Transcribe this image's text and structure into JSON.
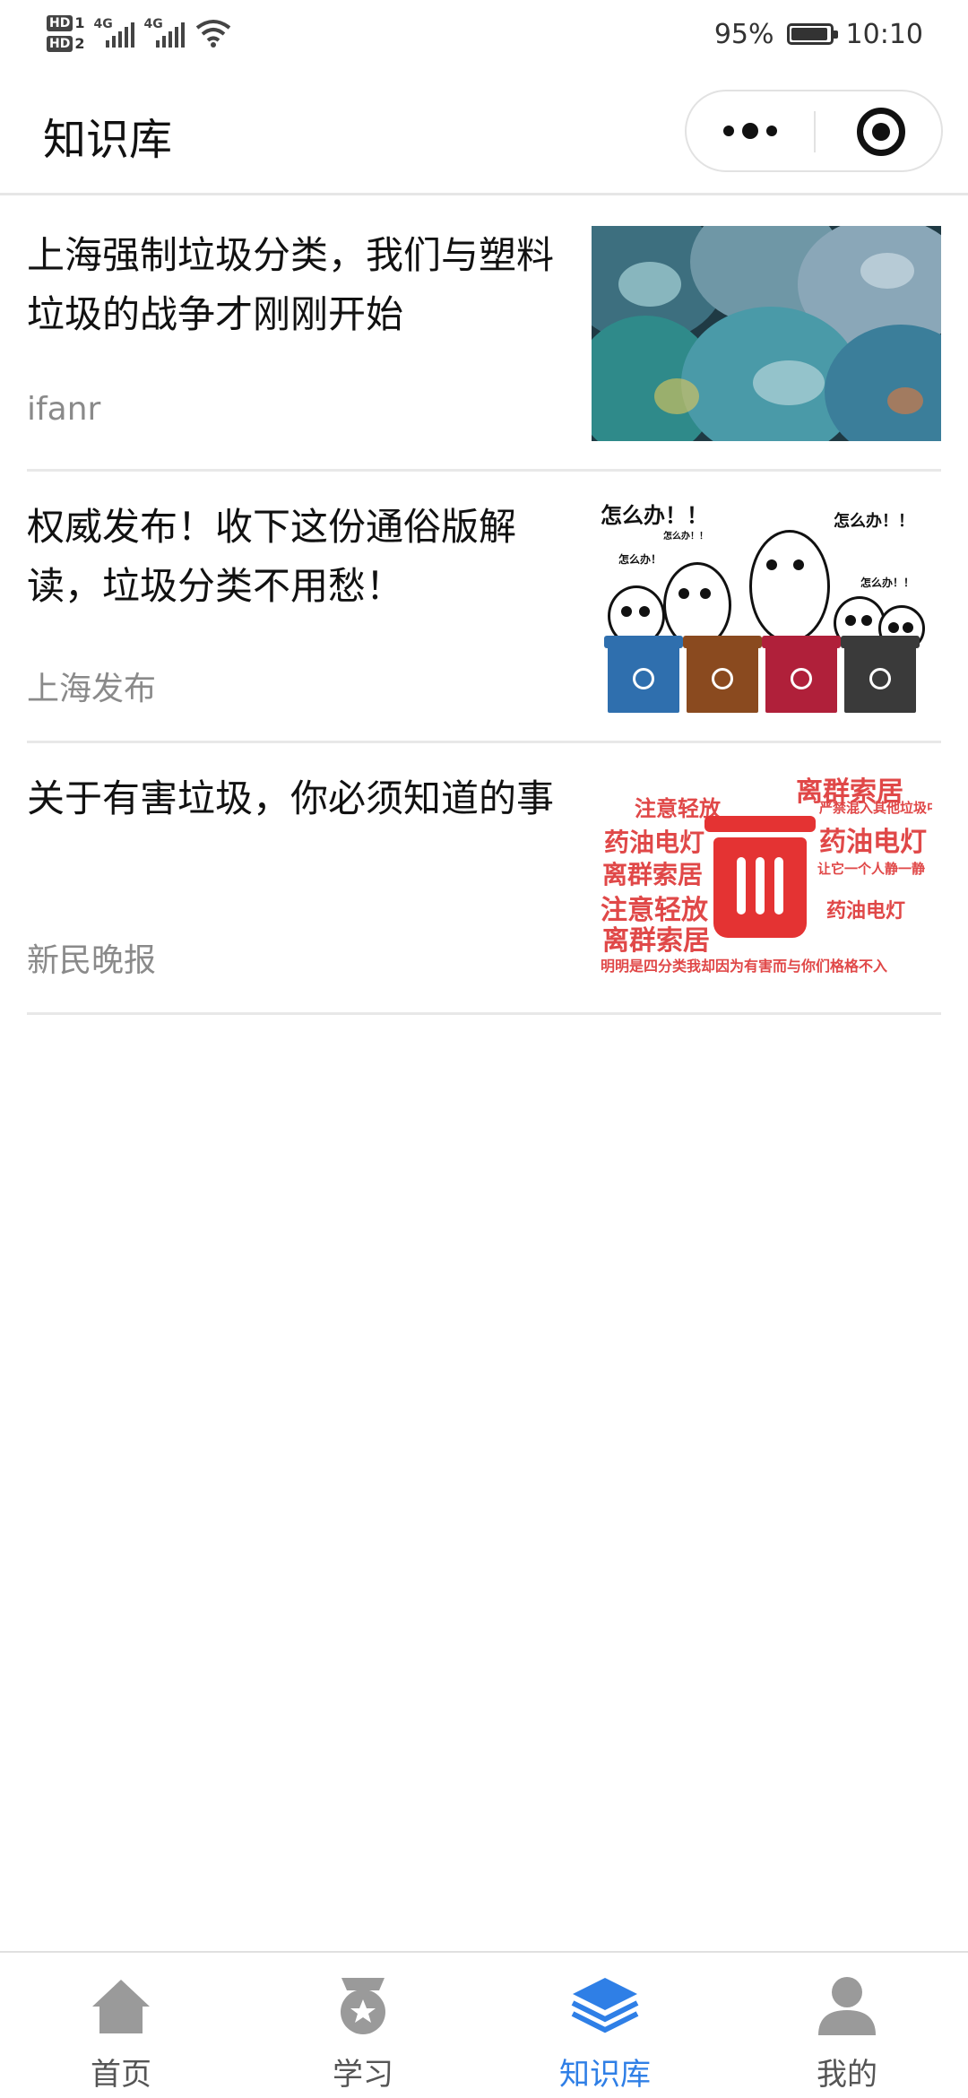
{
  "status_bar": {
    "sim1": "HD",
    "sim1_index": "1",
    "sim2": "HD",
    "sim2_index": "2",
    "network1": "4G",
    "network2": "4G",
    "battery_text": "95%",
    "battery_level": 0.95,
    "time": "10:10"
  },
  "header": {
    "title": "知识库",
    "more_icon": "more-dots-icon",
    "close_icon": "target-close-icon"
  },
  "articles": [
    {
      "title": "上海强制垃圾分类，我们与塑料垃圾的战争才刚刚开始",
      "source": "ifanr",
      "thumbnail": "plastic-bottle-bags-photo"
    },
    {
      "title": "权威发布！收下这份通俗版解读，垃圾分类不用愁！",
      "source": "上海发布",
      "thumbnail": "cartoon-trash-bins-illustration",
      "thumb_texts": [
        "怎么办！！",
        "怎么办！！",
        "怎么办！",
        "怎么办！！",
        "怎么办！！"
      ]
    },
    {
      "title": "关于有害垃圾，你必须知道的事",
      "source": "新民晚报",
      "thumbnail": "hazardous-waste-word-cloud",
      "thumb_texts": [
        "药油电灯",
        "离群索居",
        "注意轻放",
        "严禁混入其他垃圾中",
        "药油电灯",
        "离群索居",
        "注意轻放",
        "离群索居",
        "药油电灯",
        "让它一个人静一静",
        "明明是四分类我却因为有害而与你们格格不入"
      ]
    }
  ],
  "tabbar": {
    "active_color": "#2f7fe6",
    "tabs": [
      {
        "label": "首页",
        "icon": "home-icon",
        "active": false
      },
      {
        "label": "学习",
        "icon": "medal-star-icon",
        "active": false
      },
      {
        "label": "知识库",
        "icon": "layers-stack-icon",
        "active": true
      },
      {
        "label": "我的",
        "icon": "user-profile-icon",
        "active": false
      }
    ]
  }
}
